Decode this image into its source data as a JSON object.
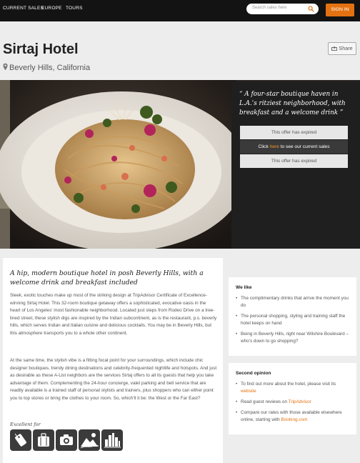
{
  "nav": {
    "items": [
      "CURRENT SALES",
      "EUROPE",
      "TOURS"
    ],
    "search_placeholder": "Search sales here",
    "signin_label": "SIGN IN"
  },
  "header": {
    "title": "Sirtaj Hotel",
    "location": "Beverly Hills, California",
    "share_label": "Share"
  },
  "offer": {
    "quote": "“ A four-star boutique haven in L.A.'s ritziest neighborhood, with breakfast and a welcome drink ”",
    "expired_label": "This offer has expired",
    "click_prefix": "Click ",
    "click_link": "here",
    "click_suffix": " to see our current sales"
  },
  "article": {
    "heading": "A hip, modern boutique hotel in posh Beverly Hills, with a welcome drink and breakfast included",
    "paragraph1": "Sleek, exotic touches make up most of the striking design at TripAdvisor Certificate of Excellence-winning Sirtaj Hotel. This 32-room boutique getaway offers a sophisticated, evocative oasis in the heart of Los Angeles' most fashionable neighborhood. Located just steps from Rodeo Drive on a tree-lined street, these stylish digs are inspired by the Indian subcontinent, as is the restaurant, p.s. beverly hills, which serves Indian and Italian cuisine and delicious cocktails. You may be in Beverly Hills, but this atmosphere transports you to a whole other continent.",
    "paragraph2": "At the same time, the stylish vibe is a fitting focal point for your surroundings, which include chic designer boutiques, trendy dining destinations and celebrity-frequented nightlife and hotspots. And just as desirable as these A-List neighbors are the services Sirtaj offers to all its guests that help you take advantage of them. Complementing the 24-hour concierge, valet parking and bell service that are readily available is a trained staff of personal stylists and trainers, plus shoppers who can either point you to top stores or bring the clothes to your room. So, which'll it be: the West or the Far East?",
    "excellent_label": "Excellent for",
    "badges": [
      "luggage-tag-icon",
      "suitcase-icon",
      "camera-icon",
      "mountains-icon",
      "city-skyline-icon"
    ]
  },
  "we_like": {
    "title": "We like",
    "items": [
      "The complimentary drinks that arrive the moment you do",
      "The personal shopping, styling and training staff the hotel keeps on hand",
      "Being in Beverly Hills, right near Wilshire Boulevard – who's down to go shopping?"
    ]
  },
  "second_opinion": {
    "title": "Second opinion",
    "item1_text": "To find out more about the hotel, please visit its ",
    "item1_link": "website",
    "item2_text": "Read guest reviews on ",
    "item2_link": "TripAdvisor",
    "item3_text": "Compare our rates with those available elsewhere online, starting with ",
    "item3_link": "Booking.com"
  },
  "colors": {
    "accent": "#e47212",
    "nav_bg": "#131313",
    "offer_bg": "#1f1f1f"
  }
}
